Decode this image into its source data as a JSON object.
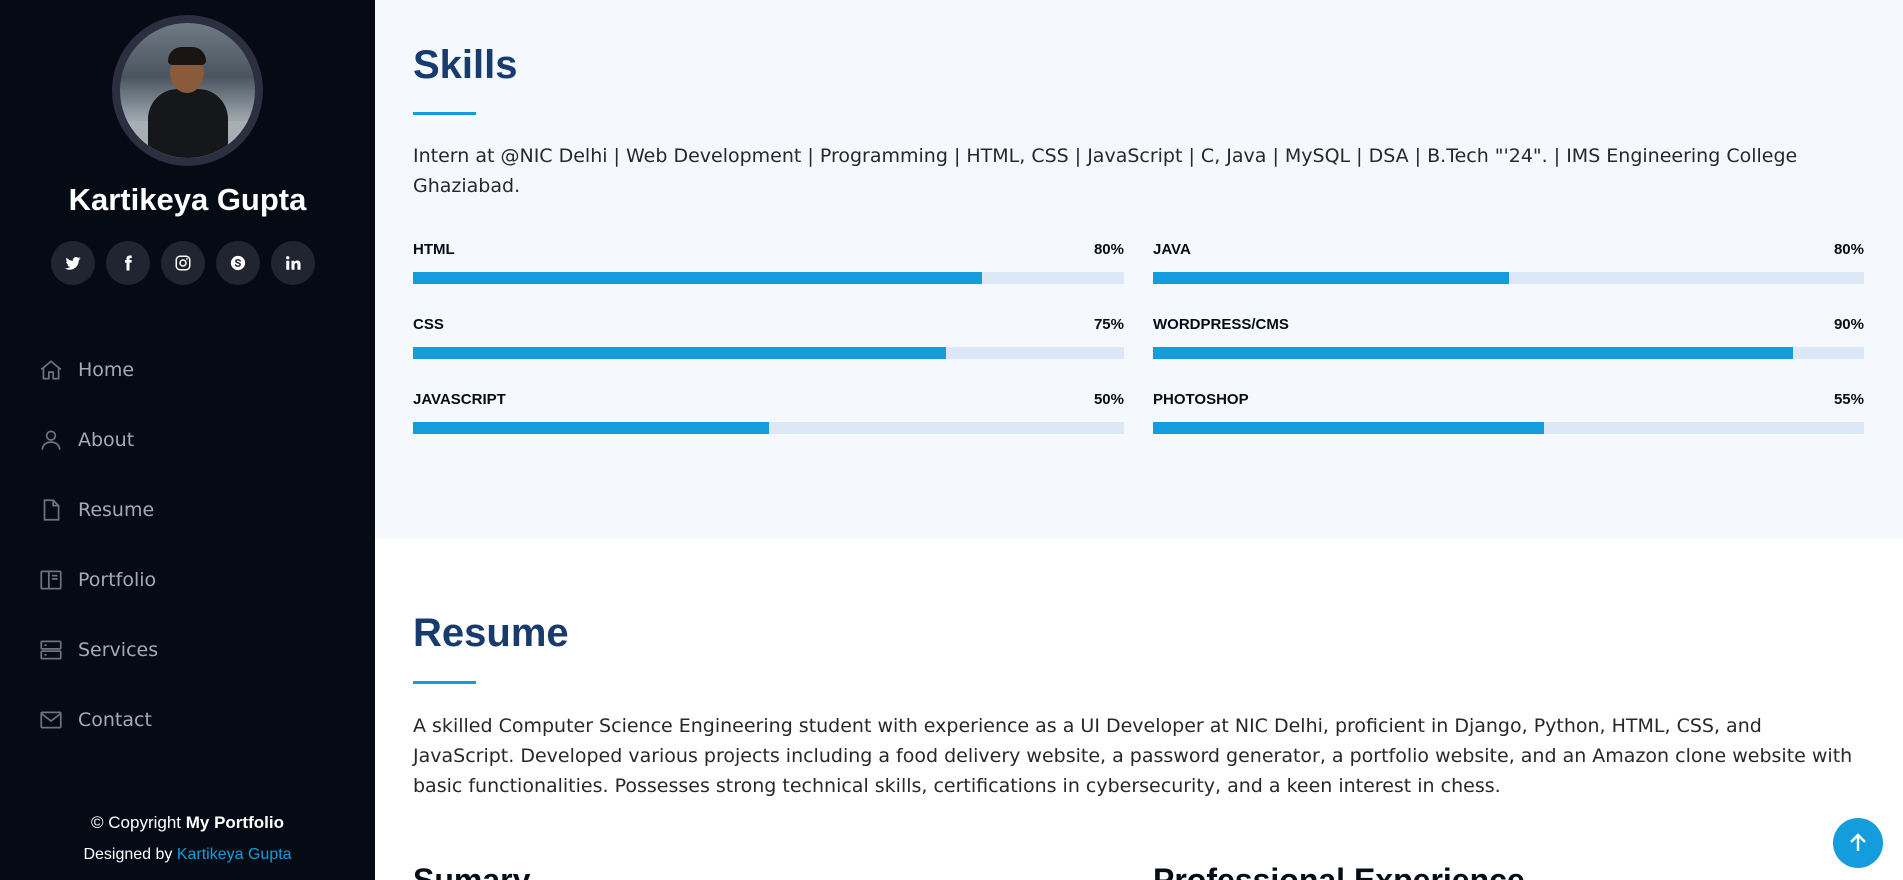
{
  "profile": {
    "name": "Kartikeya Gupta"
  },
  "socials": [
    {
      "icon": "twitter-icon",
      "glyph": "t"
    },
    {
      "icon": "facebook-icon",
      "glyph": "f"
    },
    {
      "icon": "instagram-icon",
      "glyph": "ig"
    },
    {
      "icon": "skype-icon",
      "glyph": "S"
    },
    {
      "icon": "linkedin-icon",
      "glyph": "in"
    }
  ],
  "nav": [
    {
      "label": "Home",
      "icon": "house-icon"
    },
    {
      "label": "About",
      "icon": "person-icon"
    },
    {
      "label": "Resume",
      "icon": "file-icon"
    },
    {
      "label": "Portfolio",
      "icon": "book-icon"
    },
    {
      "label": "Services",
      "icon": "server-icon"
    },
    {
      "label": "Contact",
      "icon": "envelope-icon"
    }
  ],
  "footer": {
    "copyright_prefix": "© Copyright ",
    "copyright_strong": "My Portfolio",
    "credits_prefix": "Designed by ",
    "credits_link": "Kartikeya Gupta"
  },
  "skills": {
    "title": "Skills",
    "description": "Intern at @NIC Delhi | Web Development | Programming | HTML, CSS | JavaScript | C, Java | MySQL | DSA | B.Tech \"'24\". | IMS Engineering College Ghaziabad.",
    "items": [
      {
        "name": "HTML",
        "value": "80%",
        "level": 0.8
      },
      {
        "name": "JAVA",
        "value": "80%",
        "level": 0.5
      },
      {
        "name": "CSS",
        "value": "75%",
        "level": 0.75
      },
      {
        "name": "WORDPRESS/CMS",
        "value": "90%",
        "level": 0.9
      },
      {
        "name": "JAVASCRIPT",
        "value": "50%",
        "level": 0.5
      },
      {
        "name": "PHOTOSHOP",
        "value": "55%",
        "level": 0.55
      }
    ]
  },
  "resume": {
    "title": "Resume",
    "description": "A skilled Computer Science Engineering student with experience as a UI Developer at NIC Delhi, proficient in Django, Python, HTML, CSS, and JavaScript. Developed various projects including a food delivery website, a password generator, a portfolio website, and an Amazon clone website with basic functionalities. Possesses strong technical skills, certifications in cybersecurity, and a keen interest in chess.",
    "summary_title": "Sumary",
    "experience_title": "Professional Experience"
  },
  "colors": {
    "accent": "#149ddd",
    "sidebar_bg": "#040b14",
    "title": "#173b6c"
  }
}
